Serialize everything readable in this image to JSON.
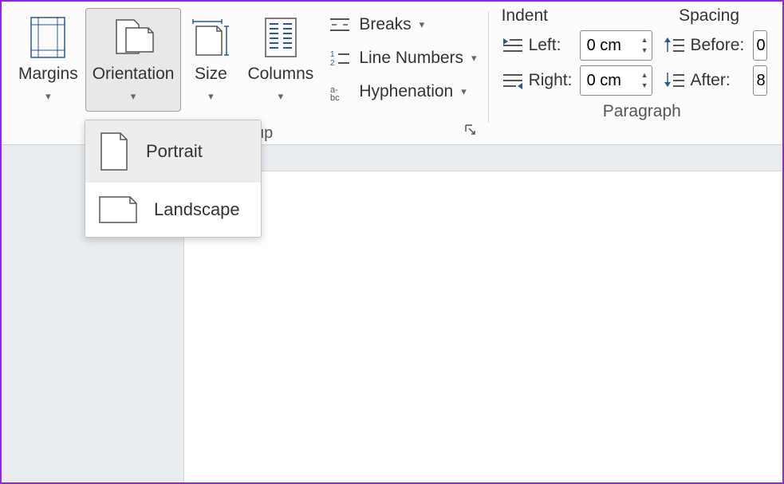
{
  "ribbon": {
    "pageSetup": {
      "margins": "Margins",
      "orientation": "Orientation",
      "size": "Size",
      "columns": "Columns",
      "breaks": "Breaks",
      "lineNumbers": "Line Numbers",
      "hyphenation": "Hyphenation",
      "groupLabelSuffix": "up"
    },
    "paragraph": {
      "indentHeading": "Indent",
      "spacingHeading": "Spacing",
      "leftLabel": "Left:",
      "rightLabel": "Right:",
      "beforeLabel": "Before:",
      "afterLabel": "After:",
      "leftValue": "0 cm",
      "rightValue": "0 cm",
      "beforeValue": "0",
      "afterValue": "8",
      "groupLabel": "Paragraph"
    }
  },
  "orientationMenu": {
    "portrait": "Portrait",
    "landscape": "Landscape"
  }
}
